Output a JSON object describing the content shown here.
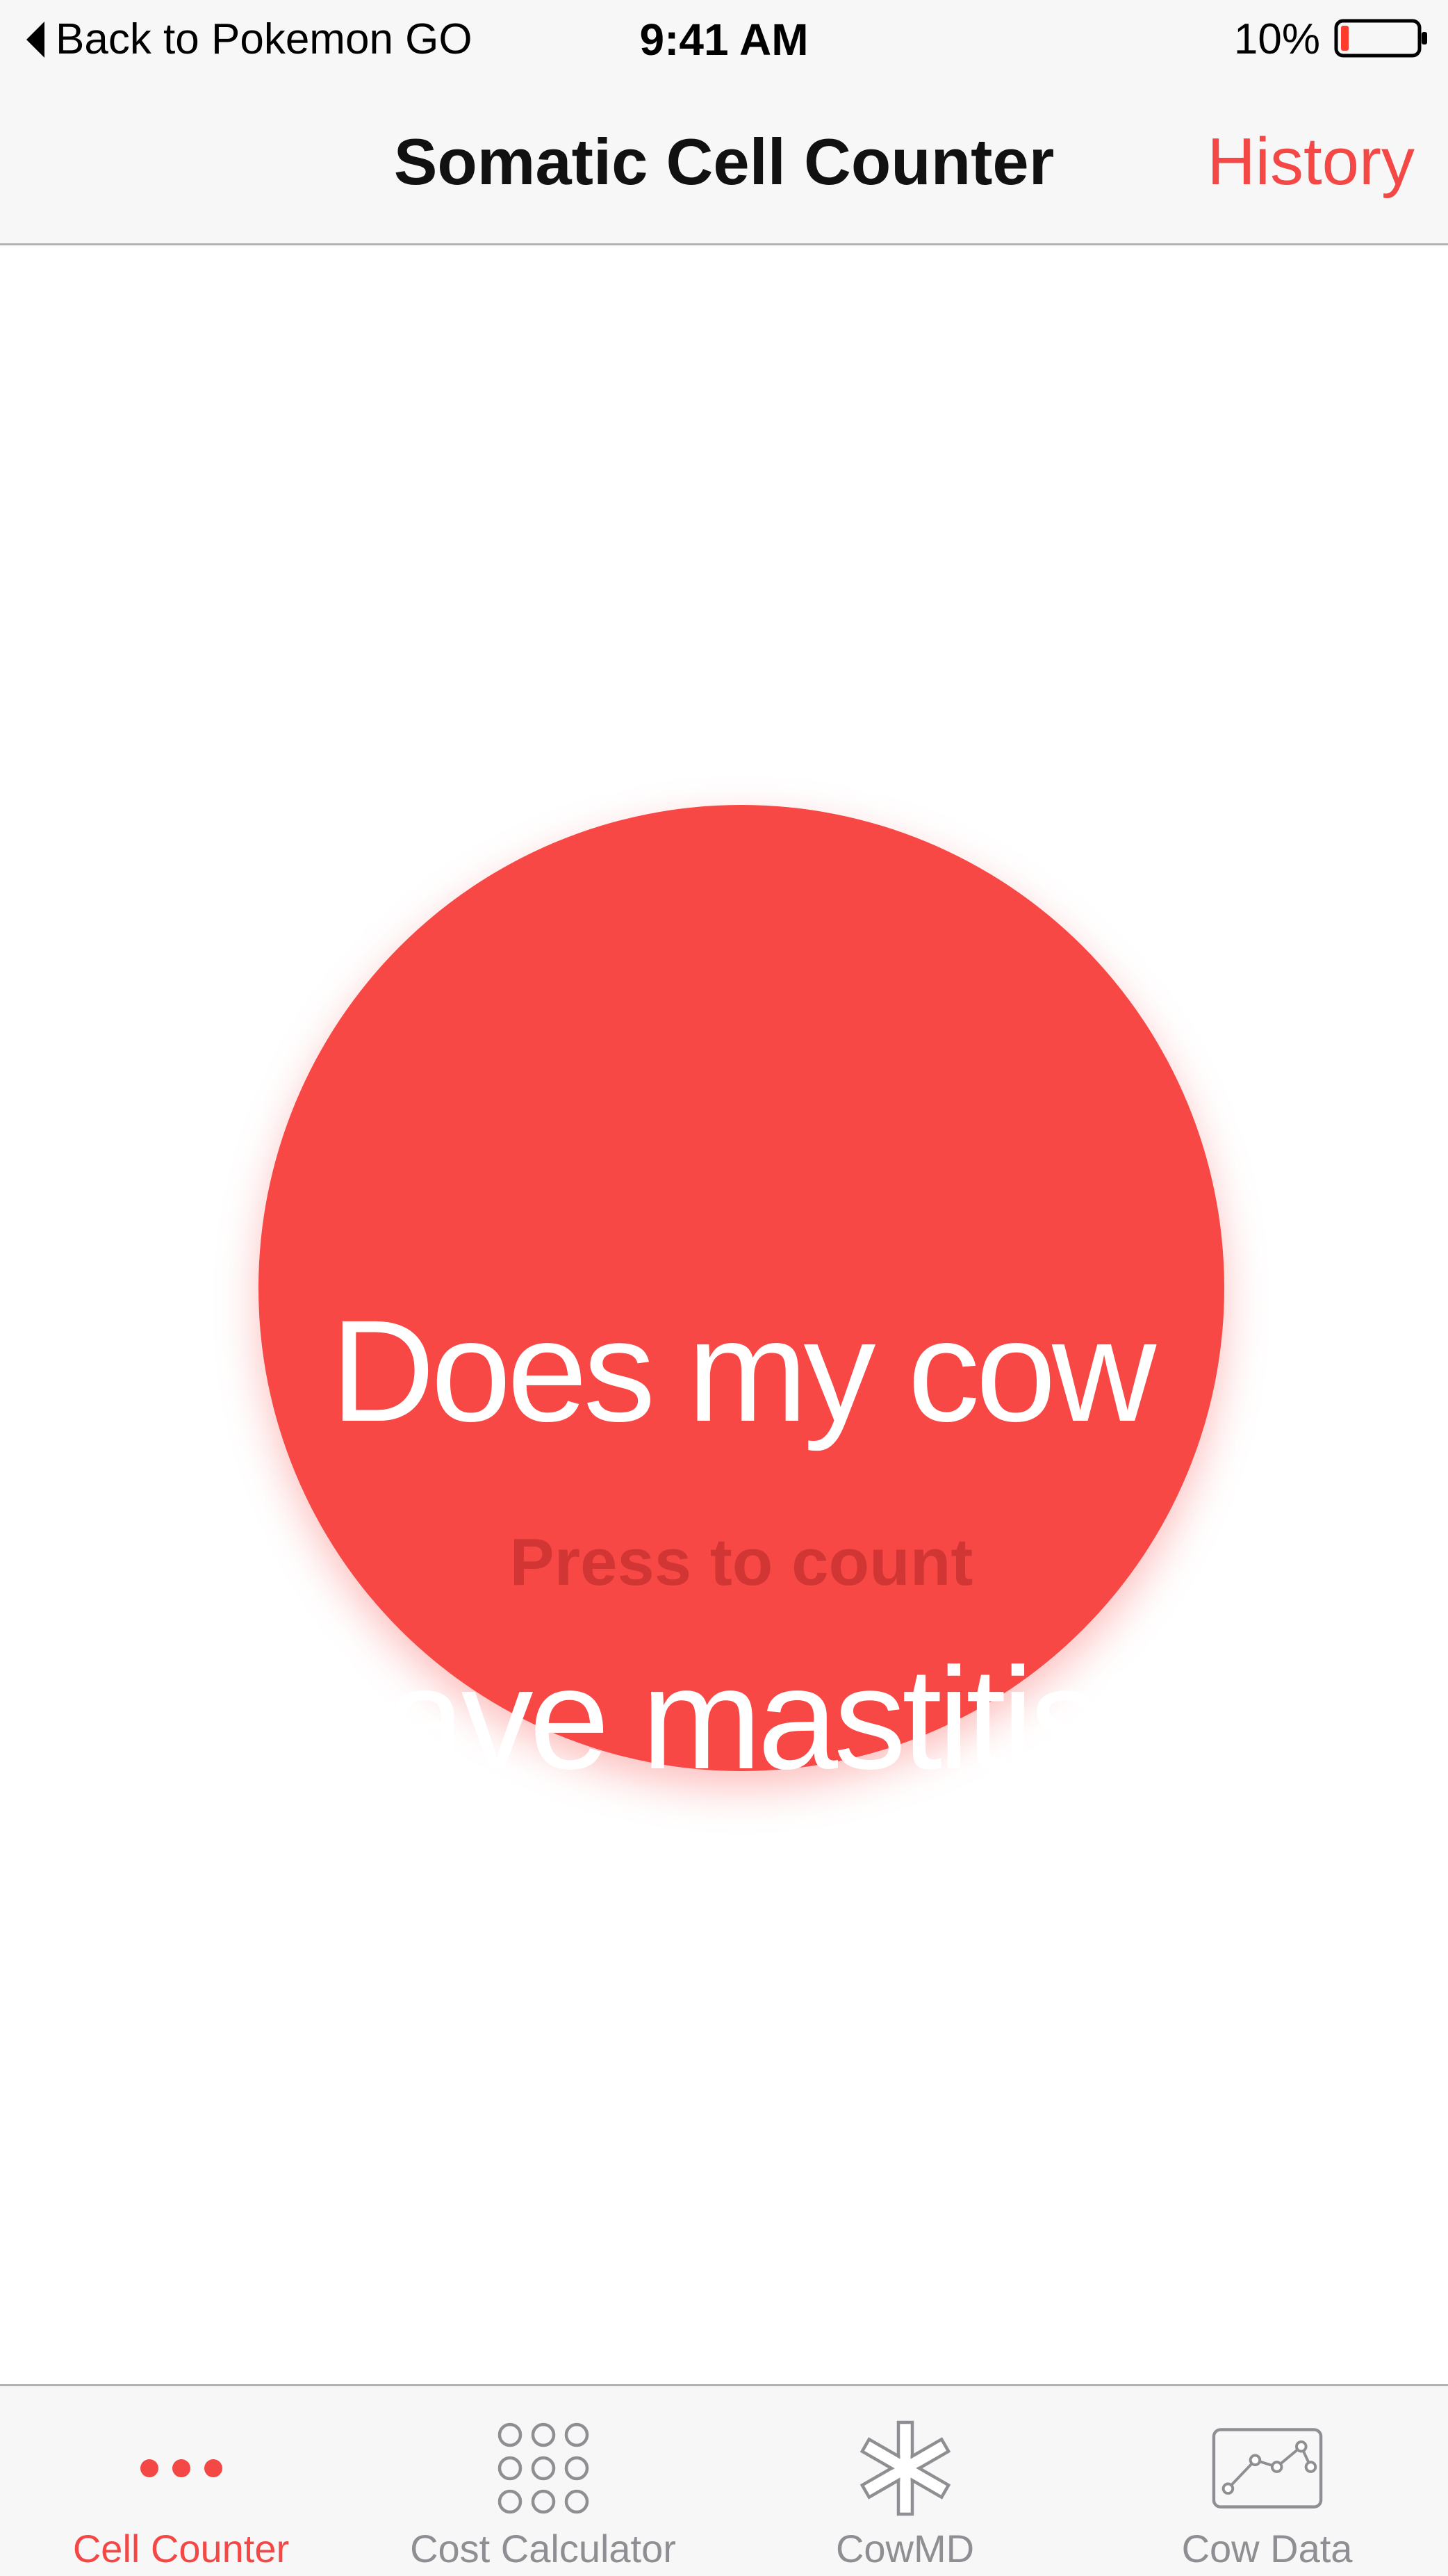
{
  "status_bar": {
    "back_label": "Back to Pokemon GO",
    "time": "9:41 AM",
    "battery_percent": "10%",
    "battery_level": 0.1
  },
  "nav": {
    "title": "Somatic Cell Counter",
    "history_label": "History"
  },
  "main": {
    "question_line1": "Does my cow",
    "question_line2": "have mastitis?",
    "hint": "Press to count"
  },
  "tabs": [
    {
      "label": "Cell Counter",
      "icon": "three-dots-icon",
      "active": true
    },
    {
      "label": "Cost Calculator",
      "icon": "keypad-grid-icon",
      "active": false
    },
    {
      "label": "CowMD",
      "icon": "medical-asterisk-icon",
      "active": false
    },
    {
      "label": "Cow Data",
      "icon": "line-chart-icon",
      "active": false
    }
  ],
  "colors": {
    "accent": "#f34845",
    "circle": "#f74845",
    "hint": "#d23634",
    "inactive": "#8e8e93",
    "bar_background": "#f7f7f7"
  }
}
